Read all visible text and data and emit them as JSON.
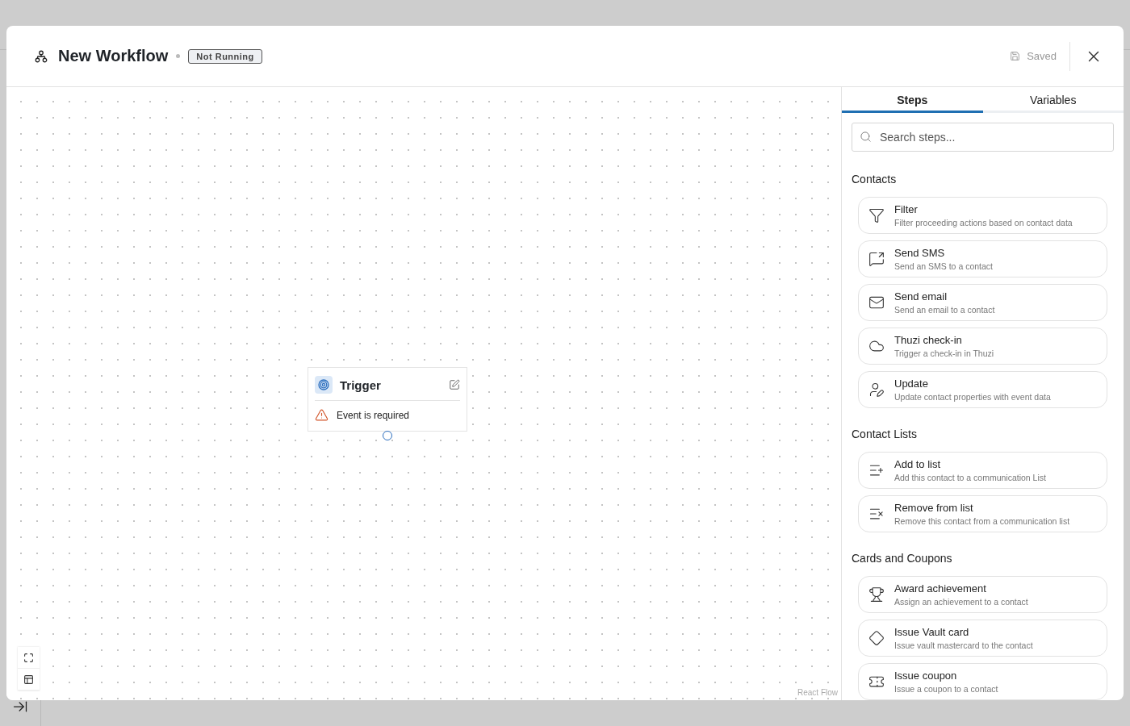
{
  "workflow": {
    "title": "New Workflow",
    "status": "Not Running",
    "save_state": "Saved"
  },
  "canvas": {
    "node": {
      "title": "Trigger",
      "warning": "Event is required"
    },
    "attribution": "React Flow"
  },
  "tabs": [
    {
      "label": "Steps",
      "selected": true
    },
    {
      "label": "Variables",
      "selected": false
    }
  ],
  "search": {
    "placeholder": "Search steps..."
  },
  "sections": [
    {
      "title": "Contacts",
      "steps": [
        {
          "kind": "filter",
          "name": "Filter",
          "description": "Filter proceeding actions based on contact data"
        },
        {
          "kind": "sms",
          "name": "Send SMS",
          "description": "Send an SMS to a contact"
        },
        {
          "kind": "email",
          "name": "Send email",
          "description": "Send an email to a contact"
        },
        {
          "kind": "checkin",
          "name": "Thuzi check-in",
          "description": "Trigger a check-in in Thuzi"
        },
        {
          "kind": "update",
          "name": "Update",
          "description": "Update contact properties with event data"
        }
      ]
    },
    {
      "title": "Contact Lists",
      "steps": [
        {
          "kind": "add_list",
          "name": "Add to list",
          "description": "Add this contact to a communication List"
        },
        {
          "kind": "remove_list",
          "name": "Remove from list",
          "description": "Remove this contact from a communication list"
        }
      ]
    },
    {
      "title": "Cards and Coupons",
      "steps": [
        {
          "kind": "award",
          "name": "Award achievement",
          "description": "Assign an achievement to a contact"
        },
        {
          "kind": "card",
          "name": "Issue Vault card",
          "description": "Issue vault mastercard to the contact"
        },
        {
          "kind": "coupon",
          "name": "Issue coupon",
          "description": "Issue a coupon to a contact"
        }
      ]
    }
  ]
}
